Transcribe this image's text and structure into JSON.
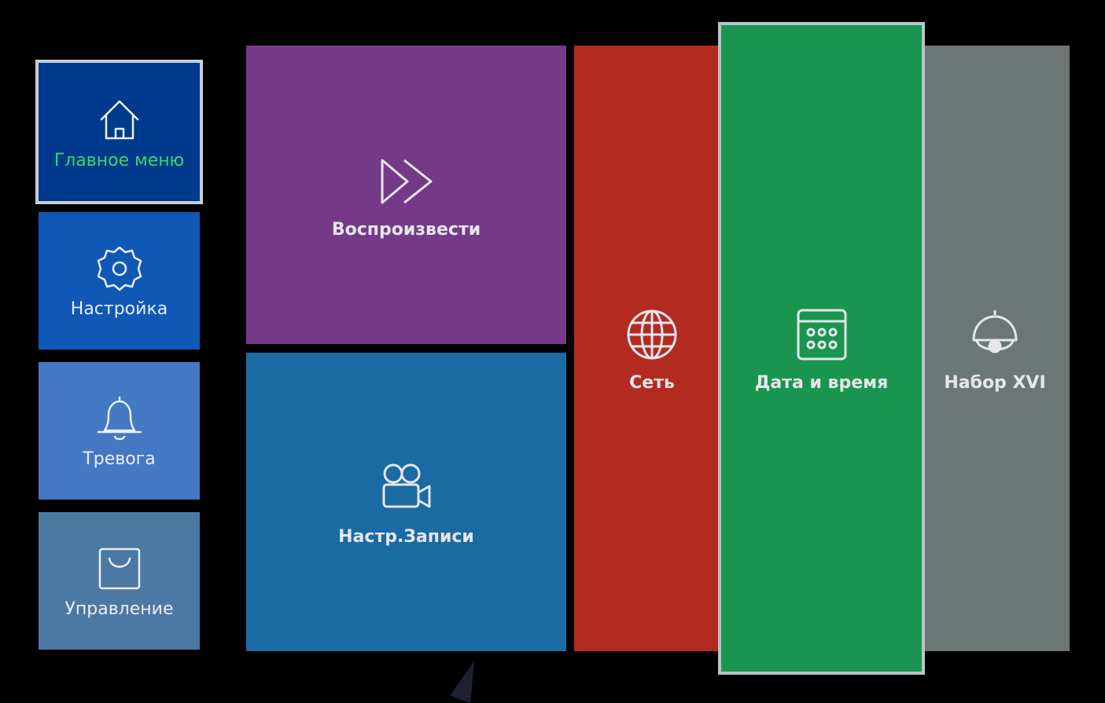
{
  "sidebar": {
    "items": [
      {
        "label": "Главное меню",
        "icon": "home-icon",
        "color": "#003a8c",
        "selected": true,
        "label_color": "#3fd36b"
      },
      {
        "label": "Настройка",
        "icon": "gear-icon",
        "color": "#1058b5"
      },
      {
        "label": "Тревога",
        "icon": "bell-icon",
        "color": "#4478c2"
      },
      {
        "label": "Управление",
        "icon": "bag-icon",
        "color": "#4c79a3"
      }
    ]
  },
  "tiles": [
    {
      "label": "Воспроизвести",
      "icon": "fast-forward-icon",
      "color": "#743a88"
    },
    {
      "label": "Настр.Записи",
      "icon": "video-camera-icon",
      "color": "#1a6aa4"
    },
    {
      "label": "Сеть",
      "icon": "globe-icon",
      "color": "#b32a21"
    },
    {
      "label": "Дата и время",
      "icon": "calendar-icon",
      "color": "#1a9550",
      "focused": true
    },
    {
      "label": "Набор XVI",
      "icon": "dome-camera-icon",
      "color": "#6c7775"
    }
  ]
}
